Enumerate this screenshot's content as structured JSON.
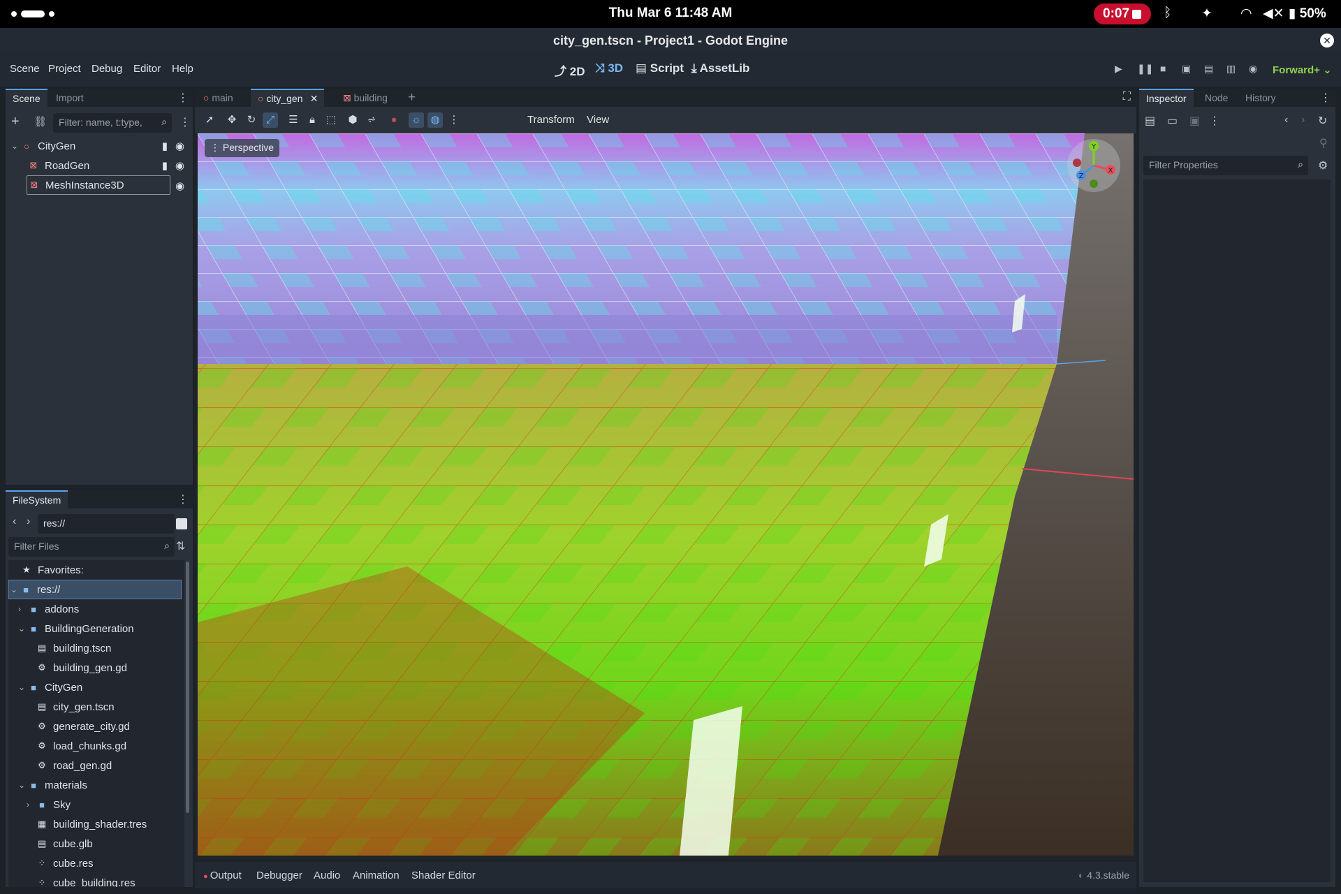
{
  "status_bar": {
    "datetime": "Thu Mar 6  11:48 AM",
    "recording_time": "0:07",
    "battery": "50%",
    "icons": [
      "bluetooth-icon",
      "accessibility-icon",
      "wifi-icon",
      "mute-icon",
      "battery-icon"
    ]
  },
  "window": {
    "title": "city_gen.tscn - Project1 - Godot Engine"
  },
  "menu": {
    "items": [
      "Scene",
      "Project",
      "Debug",
      "Editor",
      "Help"
    ],
    "workspaces": [
      "2D",
      "3D",
      "Script",
      "AssetLib"
    ],
    "active_workspace": "3D",
    "renderer": "Forward+"
  },
  "scene_dock": {
    "tabs": [
      "Scene",
      "Import"
    ],
    "filter_placeholder": "Filter: name, t:type,",
    "tree": [
      {
        "label": "CityGen",
        "icon": "node3d-icon"
      },
      {
        "label": "RoadGen",
        "icon": "mesh-icon"
      },
      {
        "label": "MeshInstance3D",
        "icon": "mesh-icon"
      }
    ]
  },
  "filesystem": {
    "tab": "FileSystem",
    "path": "res://",
    "filter_placeholder": "Filter Files",
    "favorites_label": "Favorites:",
    "items": [
      {
        "label": "res://",
        "icon": "folder-icon",
        "depth": 0,
        "expanded": true
      },
      {
        "label": "addons",
        "icon": "folder-icon",
        "depth": 1,
        "expanded": false
      },
      {
        "label": "BuildingGeneration",
        "icon": "folder-icon",
        "depth": 1,
        "expanded": true
      },
      {
        "label": "building.tscn",
        "icon": "scene-icon",
        "depth": 2
      },
      {
        "label": "building_gen.gd",
        "icon": "gear-icon",
        "depth": 2
      },
      {
        "label": "CityGen",
        "icon": "folder-icon",
        "depth": 1,
        "expanded": true
      },
      {
        "label": "city_gen.tscn",
        "icon": "scene-icon",
        "depth": 2
      },
      {
        "label": "generate_city.gd",
        "icon": "gear-icon",
        "depth": 2
      },
      {
        "label": "load_chunks.gd",
        "icon": "gear-icon",
        "depth": 2
      },
      {
        "label": "road_gen.gd",
        "icon": "gear-icon",
        "depth": 2
      },
      {
        "label": "materials",
        "icon": "folder-icon",
        "depth": 1,
        "expanded": true
      },
      {
        "label": "Sky",
        "icon": "folder-icon",
        "depth": 2,
        "expanded": false
      },
      {
        "label": "building_shader.tres",
        "icon": "resource-icon",
        "depth": 2
      },
      {
        "label": "cube.glb",
        "icon": "scene-icon",
        "depth": 2
      },
      {
        "label": "cube.res",
        "icon": "mesh-res-icon",
        "depth": 2
      },
      {
        "label": "cube_building.res",
        "icon": "mesh-res-icon",
        "depth": 2
      }
    ]
  },
  "editor_tabs": [
    "main",
    "city_gen",
    "building"
  ],
  "active_editor_tab": "city_gen",
  "viewport_toolbar": {
    "menus": [
      "Transform",
      "View"
    ],
    "perspective_label": "Perspective"
  },
  "gizmo": {
    "y": "Y",
    "x": "X",
    "z": "Z"
  },
  "inspector": {
    "tabs": [
      "Inspector",
      "Node",
      "History"
    ],
    "filter_placeholder": "Filter Properties"
  },
  "bottom_panel": {
    "tabs": [
      "Output",
      "Debugger",
      "Audio",
      "Animation",
      "Shader Editor"
    ],
    "version": "4.3.stable"
  }
}
